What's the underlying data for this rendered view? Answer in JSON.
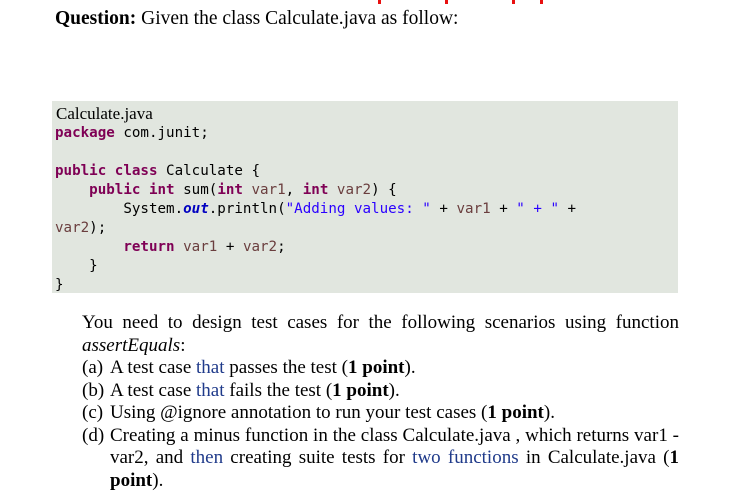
{
  "question": {
    "label": "Question:",
    "text": " Given the class Calculate.java as follow:"
  },
  "code_block": {
    "filename": "Calculate.java",
    "lines": {
      "l1_kw": "package",
      "l1_rest": " com.junit;",
      "l3_kw1": "public",
      "l3_kw2": "class",
      "l3_rest": " Calculate {",
      "l4_kw1": "public",
      "l4_kw2": "int",
      "l4_name": " sum(",
      "l4_kw3": "int",
      "l4_var1": "var1",
      "l4_sep": ", ",
      "l4_kw4": "int",
      "l4_var2": "var2",
      "l4_end": ") {",
      "l5_sys": "System.",
      "l5_out": "out",
      "l5_print": ".println(",
      "l5_str1": "\"Adding values: \"",
      "l5_plus1": " + ",
      "l5_var1": "var1",
      "l5_plus2": " + ",
      "l5_str2": "\" + \"",
      "l5_plus3": " +",
      "l6_var2": "var2",
      "l6_end": ");",
      "l7_kw": "return",
      "l7_var1": "var1",
      "l7_plus": " + ",
      "l7_var2": "var2",
      "l7_end": ";",
      "l8_brace": "}",
      "l9_brace": "}"
    }
  },
  "instructions": {
    "intro_a": "You need to design test cases for the following scenarios using function ",
    "intro_fn": "assertEquals",
    "intro_b": ":",
    "items": [
      {
        "label": "(a)",
        "pre": " A test case ",
        "mid": "that",
        "post": " passes the test (",
        "points": "1 point",
        "end": ")."
      },
      {
        "label": "(b)",
        "pre": " A test case ",
        "mid": "that",
        "post": " fails the test (",
        "points": "1 point",
        "end": ")."
      },
      {
        "label": "(c)",
        "pre": " Using @ignore annotation to run your test cases (",
        "points": "1 point",
        "end": ")."
      },
      {
        "label": "(d)",
        "pre": " Creating a minus function in the class Calculate.java , which returns var1 - var2, and ",
        "mid": "then",
        "post": " creating suite tests for ",
        "mid2": "two functions",
        "post2": " in Calculate.java  (",
        "points": "1 point",
        "end": ")."
      }
    ]
  }
}
